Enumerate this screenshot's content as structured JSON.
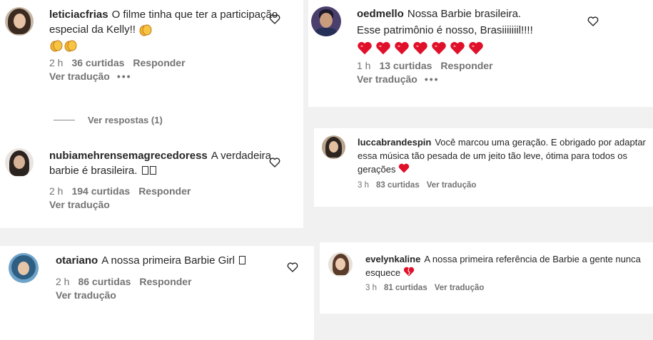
{
  "comments": [
    {
      "id": "c1",
      "username": "leticiacfrias",
      "text": "O filme tinha que ter a participação especial da Kelly!!",
      "time": "2 h",
      "likes": "36 curtidas",
      "reply": "Responder",
      "translate": "Ver tradução",
      "more": "•••",
      "view_replies": "Ver respostas (1)",
      "emoji": "clapping-hands",
      "avatar_colors": {
        "bg": "#c7b7a6",
        "hair": "#3a2a20",
        "face": "#e6c3a5"
      }
    },
    {
      "id": "c2",
      "username": "nubiamehrensemagrecedoress",
      "text": "A verdadeira barbie é brasileira.",
      "time": "2 h",
      "likes": "194 curtidas",
      "reply": "Responder",
      "translate": "Ver tradução",
      "avatar_colors": {
        "bg": "#e9e4df",
        "hair": "#2b2320",
        "face": "#d8b296"
      }
    },
    {
      "id": "c3",
      "username": "otariano",
      "text": "A nossa primeira Barbie Girl",
      "time": "2 h",
      "likes": "86 curtidas",
      "reply": "Responder",
      "translate": "Ver tradução",
      "avatar_colors": {
        "bg": "#6fa3c9",
        "hair": "#2f5e83",
        "face": "#e7c6a8"
      }
    },
    {
      "id": "c4",
      "username": "oedmello",
      "text_line1": "Nossa Barbie brasileira.",
      "text_line2": "Esse patrimônio é nosso, Brasiiiiiiil!!!!",
      "time": "1 h",
      "likes": "13 curtidas",
      "reply": "Responder",
      "translate": "Ver tradução",
      "more": "•••",
      "hearts": 7,
      "avatar_colors": {
        "bg": "#4b3f6d",
        "hair": "#1c1a2a",
        "face": "#c99c7e"
      }
    },
    {
      "id": "c5",
      "username": "luccabrandespin",
      "text": "Você marcou uma geração. E obrigado por adaptar essa música tão pesada de um jeito tão leve, ótima para todos os gerações",
      "time": "3 h",
      "likes": "83 curtidas",
      "translate": "Ver tradução",
      "avatar_colors": {
        "bg": "#b8a48d",
        "hair": "#2e2520",
        "face": "#e2bf9f"
      }
    },
    {
      "id": "c6",
      "username": "evelynkaline",
      "text": "A nossa primeira referência de Barbie a gente nunca esquece",
      "time": "3 h",
      "likes": "81 curtidas",
      "translate": "Ver tradução",
      "avatar_colors": {
        "bg": "#e8e0d8",
        "hair": "#5b3b2a",
        "face": "#eccbb1"
      }
    }
  ],
  "colors": {
    "text": "#262626",
    "muted": "#737373",
    "heart_red": "#e0102a",
    "page_bg": "#f1f1f1",
    "panel_bg": "#ffffff"
  }
}
